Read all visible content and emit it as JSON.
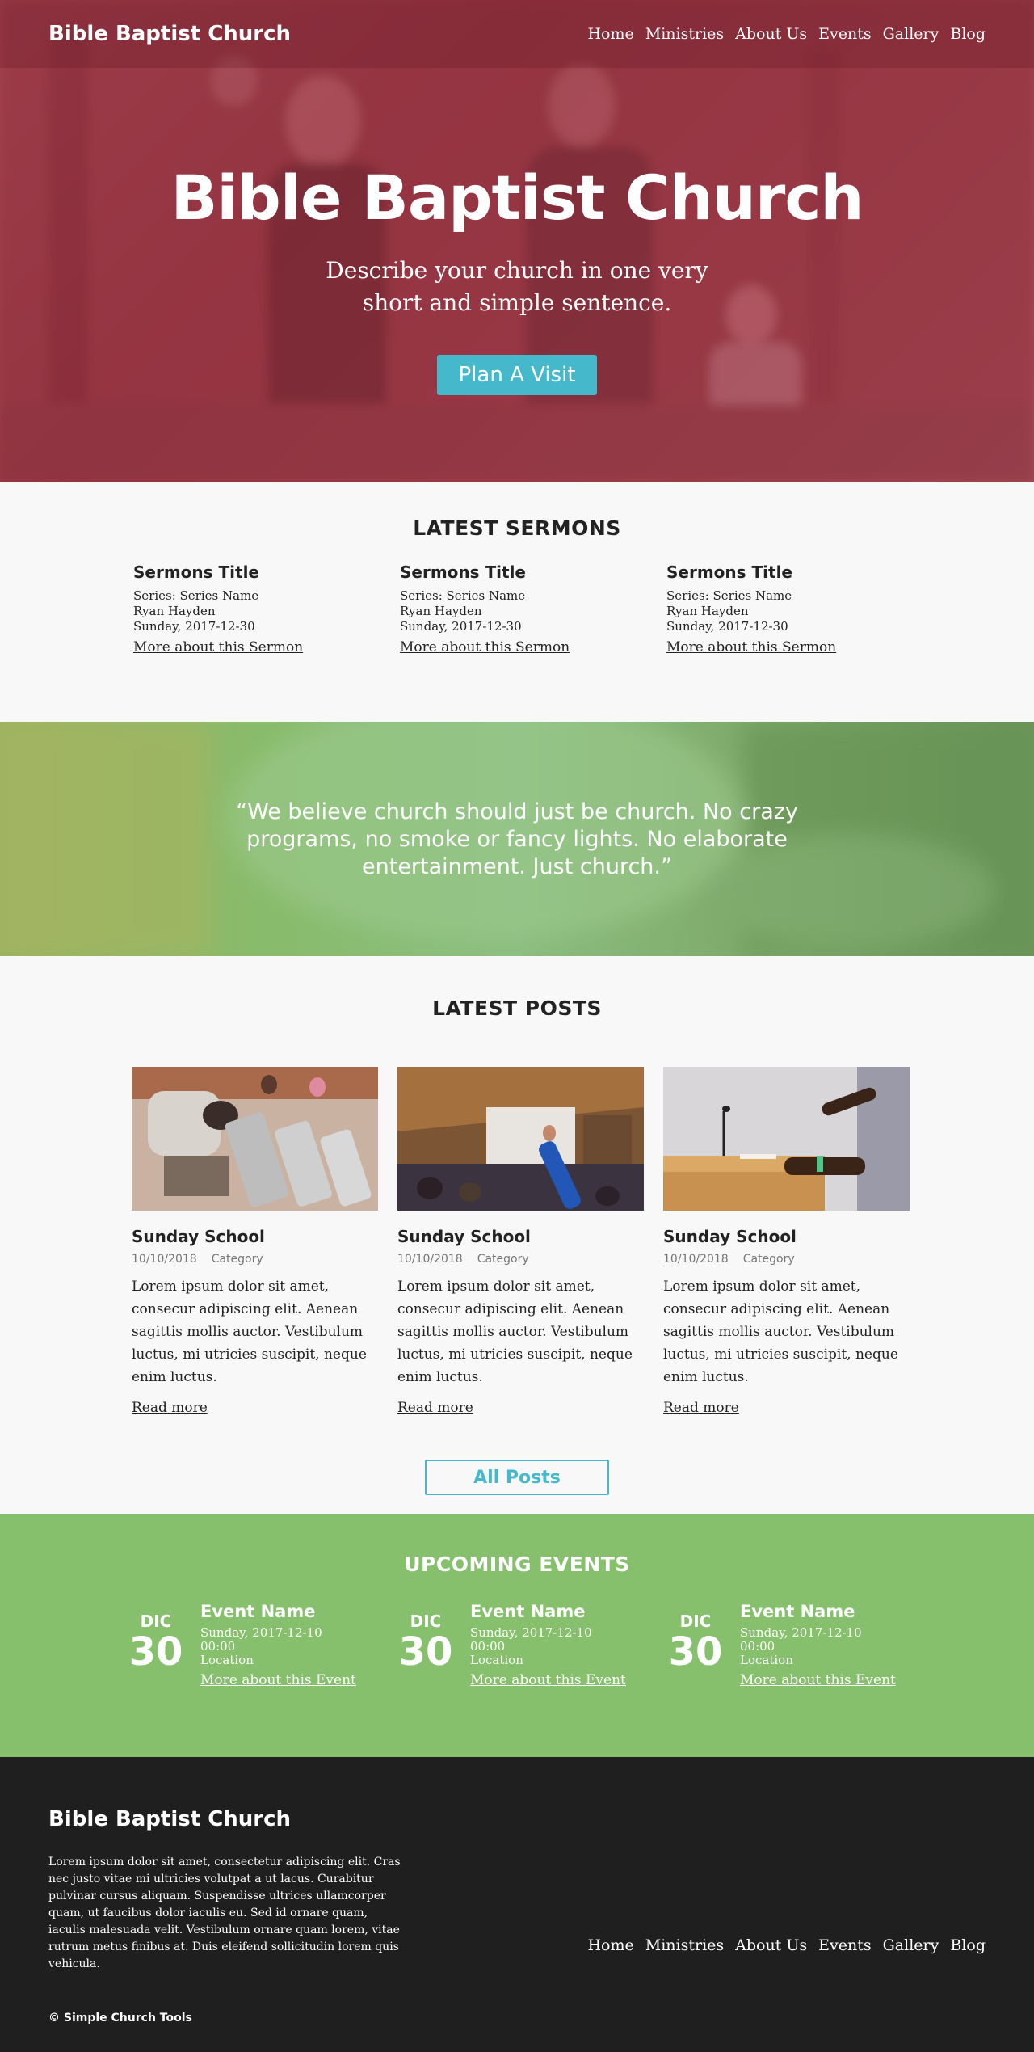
{
  "site": {
    "brand": "Bible Baptist Church"
  },
  "nav": [
    "Home",
    "Ministries",
    "About Us",
    "Events",
    "Gallery",
    "Blog"
  ],
  "hero": {
    "title": "Bible Baptist Church",
    "subtitle": "Describe your church in one very short and simple sentence.",
    "cta": "Plan A Visit"
  },
  "sermons": {
    "heading": "LATEST SERMONS",
    "items": [
      {
        "title": "Sermons Title",
        "series": "Series: Series Name",
        "speaker": "Ryan Hayden",
        "date": "Sunday, 2017-12-30",
        "link": "More about this Sermon"
      },
      {
        "title": "Sermons Title",
        "series": "Series: Series Name",
        "speaker": "Ryan Hayden",
        "date": "Sunday, 2017-12-30",
        "link": "More about this Sermon"
      },
      {
        "title": "Sermons Title",
        "series": "Series: Series Name",
        "speaker": "Ryan Hayden",
        "date": "Sunday, 2017-12-30",
        "link": "More about this Sermon"
      }
    ]
  },
  "quote": {
    "text": "“We believe church should just be church.  No crazy programs, no smoke or fancy lights.  No elaborate entertainment. Just church.”"
  },
  "posts": {
    "heading": "LATEST POSTS",
    "items": [
      {
        "title": "Sunday School",
        "date": "10/10/2018",
        "category": "Category",
        "excerpt": "Lorem ipsum dolor sit amet, consecur adipiscing elit. Aenean sagittis mollis auctor. Vestibulum luctus, mi utricies suscipit, neque enim luctus.",
        "link": "Read more"
      },
      {
        "title": "Sunday School",
        "date": "10/10/2018",
        "category": "Category",
        "excerpt": "Lorem ipsum dolor sit amet, consecur adipiscing elit. Aenean sagittis mollis auctor. Vestibulum luctus, mi utricies suscipit, neque enim luctus.",
        "link": "Read more"
      },
      {
        "title": "Sunday School",
        "date": "10/10/2018",
        "category": "Category",
        "excerpt": "Lorem ipsum dolor sit amet, consecur adipiscing elit. Aenean sagittis mollis auctor. Vestibulum luctus, mi utricies suscipit, neque enim luctus.",
        "link": "Read more"
      }
    ],
    "all_posts": "All Posts"
  },
  "events": {
    "heading": "UPCOMING EVENTS",
    "items": [
      {
        "month": "DIC",
        "day": "30",
        "name": "Event Name",
        "date": "Sunday, 2017-12-10",
        "time": "00:00",
        "location": "Location",
        "link": "More about this Event"
      },
      {
        "month": "DIC",
        "day": "30",
        "name": "Event Name",
        "date": "Sunday, 2017-12-10",
        "time": "00:00",
        "location": "Location",
        "link": "More about this Event"
      },
      {
        "month": "DIC",
        "day": "30",
        "name": "Event Name",
        "date": "Sunday, 2017-12-10",
        "time": "00:00",
        "location": "Location",
        "link": "More about this Event"
      }
    ]
  },
  "footer": {
    "brand": "Bible Baptist Church",
    "text": "Lorem ipsum dolor sit amet, consectetur adipiscing elit. Cras nec justo vitae mi ultricies volutpat a ut lacus. Curabitur pulvinar cursus aliquam. Suspendisse ultrices ullamcorper quam, ut faucibus dolor iaculis eu. Sed id ornare quam, iaculis malesuada velit. Vestibulum ornare quam lorem, vitae rutrum metus finibus at. Duis eleifend sollicitudin lorem quis vehicula.",
    "copyright": "© Simple Church Tools"
  },
  "colors": {
    "accent": "#45b8cc",
    "events_bg": "#86c06c",
    "footer_bg": "#1f1f1f",
    "hero_tint": "#9c4450"
  }
}
